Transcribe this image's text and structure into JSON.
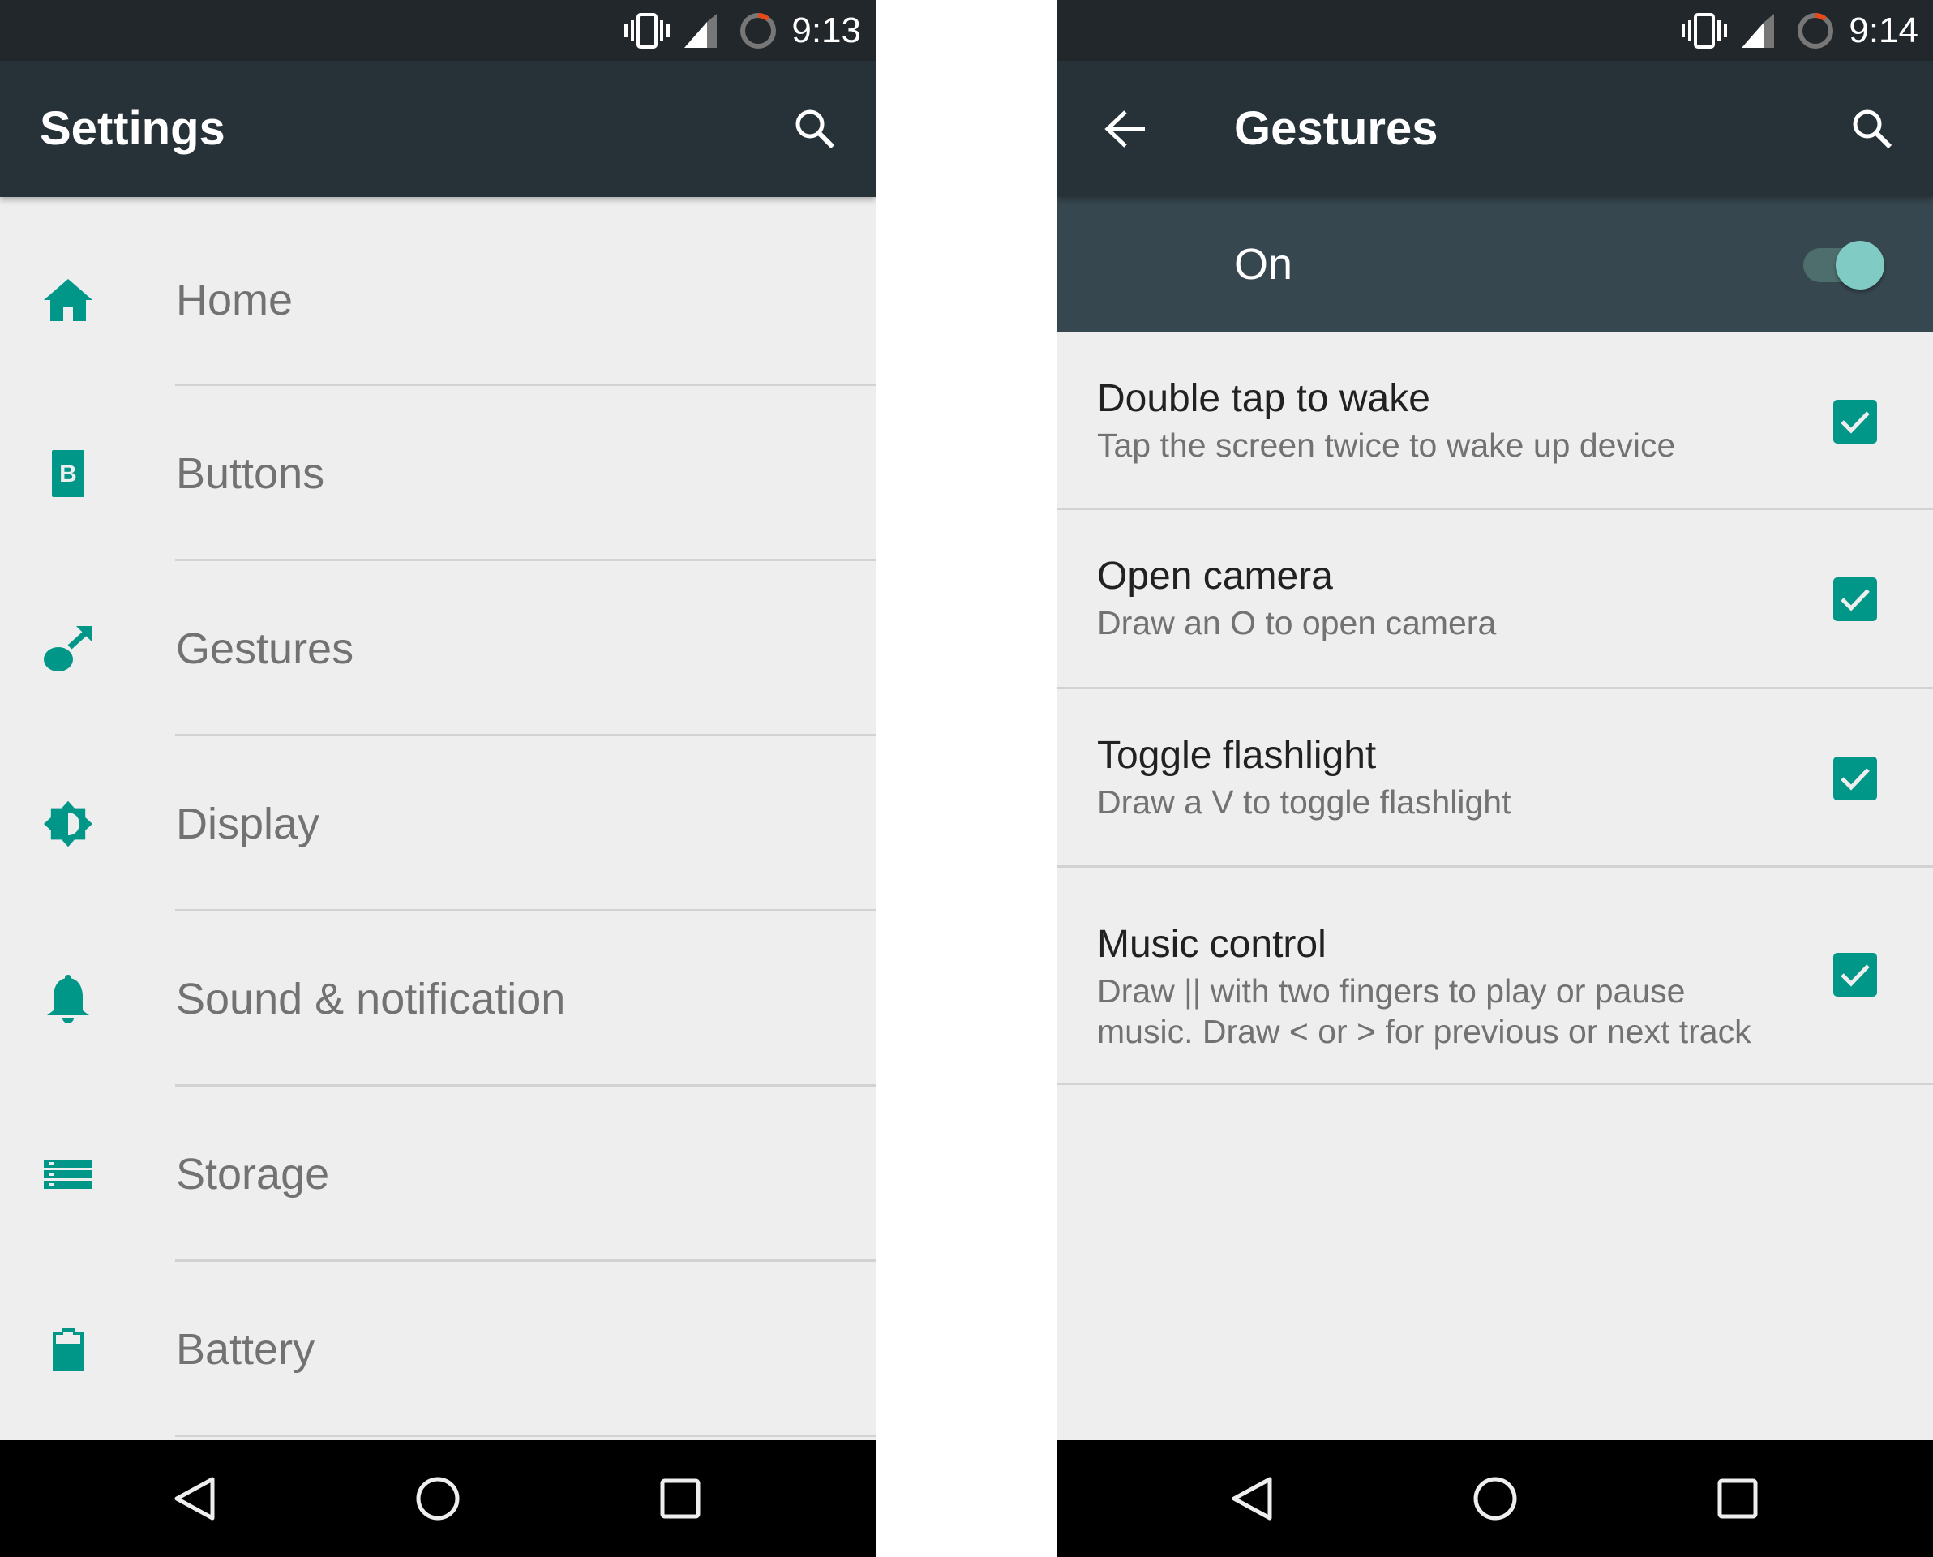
{
  "colors": {
    "accent": "#009688",
    "status_bar": "#21272b",
    "toolbar": "#263238",
    "master_bar": "#37474f",
    "background": "#eeeeee",
    "switch_thumb": "#80cbc4",
    "battery_low": "#e64a19"
  },
  "left_screen": {
    "status_bar": {
      "icons": [
        "vibrate-icon",
        "cell-signal-icon",
        "battery-ring-icon"
      ],
      "time": "9:13"
    },
    "toolbar": {
      "title": "Settings",
      "search_icon": "search-icon"
    },
    "settings_items": [
      {
        "label": "Home",
        "icon": "home-icon"
      },
      {
        "label": "Buttons",
        "icon": "buttons-b-icon"
      },
      {
        "label": "Gestures",
        "icon": "gesture-icon"
      },
      {
        "label": "Display",
        "icon": "brightness-icon"
      },
      {
        "label": "Sound & notification",
        "icon": "bell-icon"
      },
      {
        "label": "Storage",
        "icon": "storage-icon"
      },
      {
        "label": "Battery",
        "icon": "battery-icon"
      }
    ],
    "nav_bar": {
      "back": "back-triangle-icon",
      "home": "home-circle-icon",
      "recents": "recents-square-icon"
    }
  },
  "right_screen": {
    "status_bar": {
      "icons": [
        "vibrate-icon",
        "cell-signal-icon",
        "battery-ring-icon"
      ],
      "time": "9:14"
    },
    "toolbar": {
      "title": "Gestures",
      "back_icon": "arrow-back-icon",
      "search_icon": "search-icon"
    },
    "master_switch": {
      "label": "On",
      "checked": true
    },
    "gestures": [
      {
        "title": "Double tap to wake",
        "subtitle": "Tap the screen twice to wake up device",
        "checked": true
      },
      {
        "title": "Open camera",
        "subtitle": "Draw an O to open camera",
        "checked": true
      },
      {
        "title": "Toggle flashlight",
        "subtitle": "Draw a V to toggle flashlight",
        "checked": true
      },
      {
        "title": "Music control",
        "subtitle": "Draw || with two fingers to play or pause music. Draw < or > for previous or next track",
        "checked": true
      }
    ],
    "nav_bar": {
      "back": "back-triangle-icon",
      "home": "home-circle-icon",
      "recents": "recents-square-icon"
    }
  }
}
